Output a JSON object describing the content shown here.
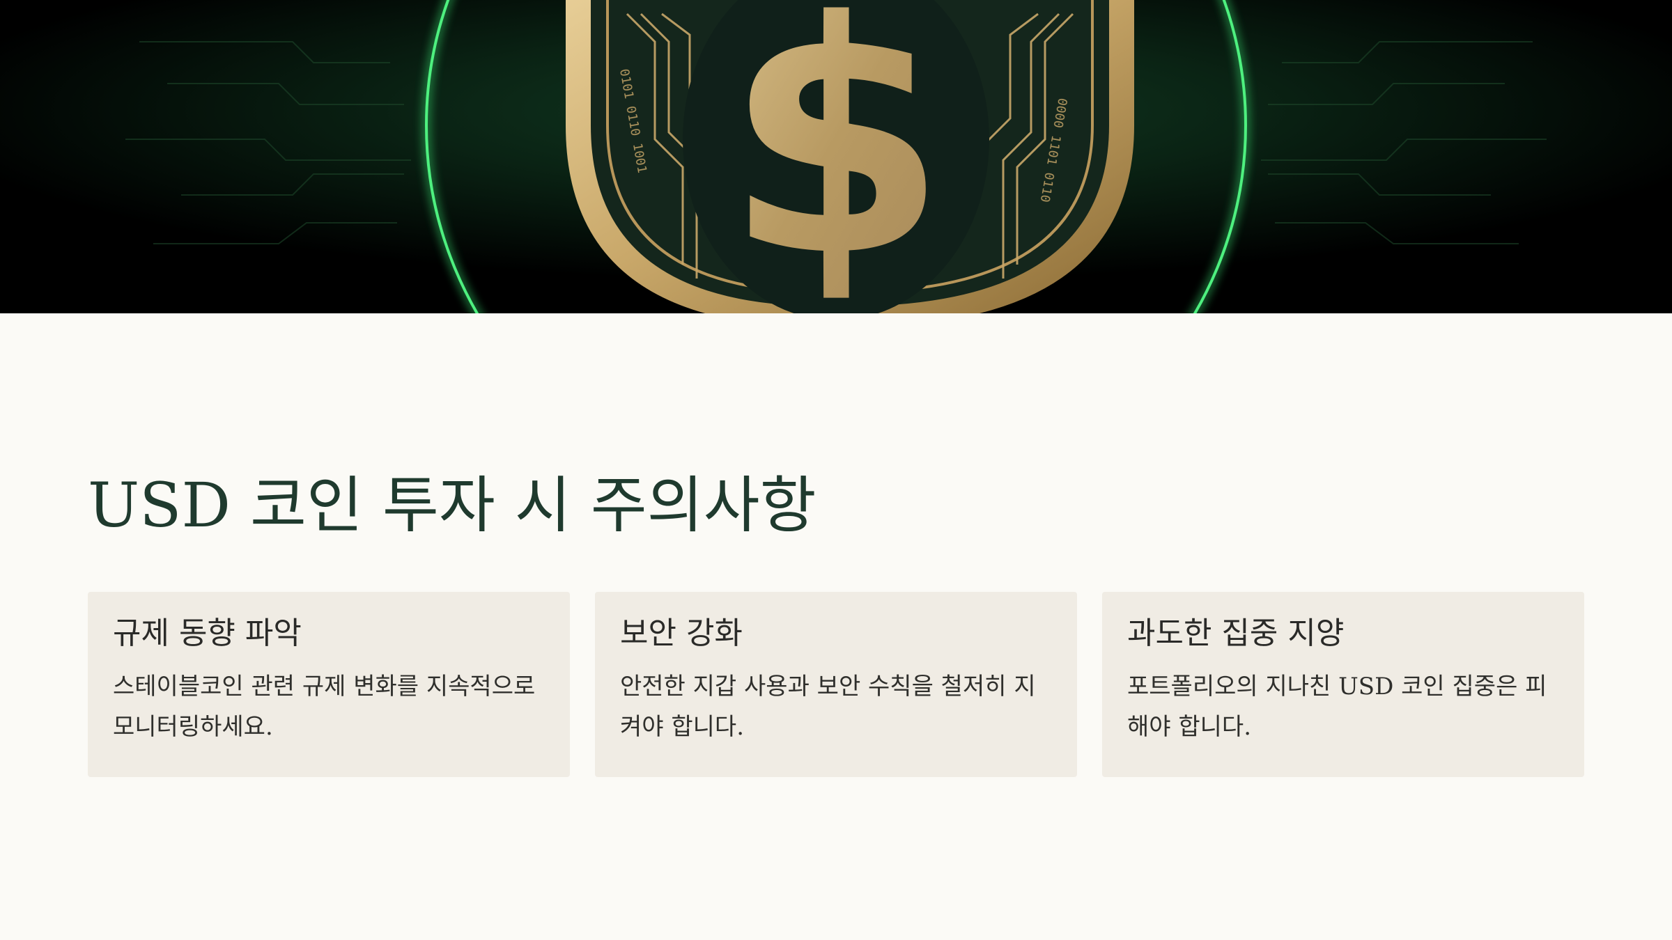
{
  "hero": {
    "image_description": "gold-shield-dollar-circuit",
    "accent_color": "#35d36a",
    "gold_color": "#c9a86a"
  },
  "page": {
    "title": "USD 코인 투자 시 주의사항"
  },
  "cards": [
    {
      "title": "규제 동향 파악",
      "body": "스테이블코인 관련 규제 변화를 지속적으로 모니터링하세요."
    },
    {
      "title": "보안 강화",
      "body": "안전한 지갑 사용과 보안 수칙을 철저히 지켜야 합니다."
    },
    {
      "title": "과도한 집중 지양",
      "body": "포트폴리오의 지나친 USD 코인 집중은 피해야 합니다."
    }
  ],
  "colors": {
    "background": "#fbfaf6",
    "card_background": "#f0ece4",
    "title_color": "#1f3a2e"
  }
}
